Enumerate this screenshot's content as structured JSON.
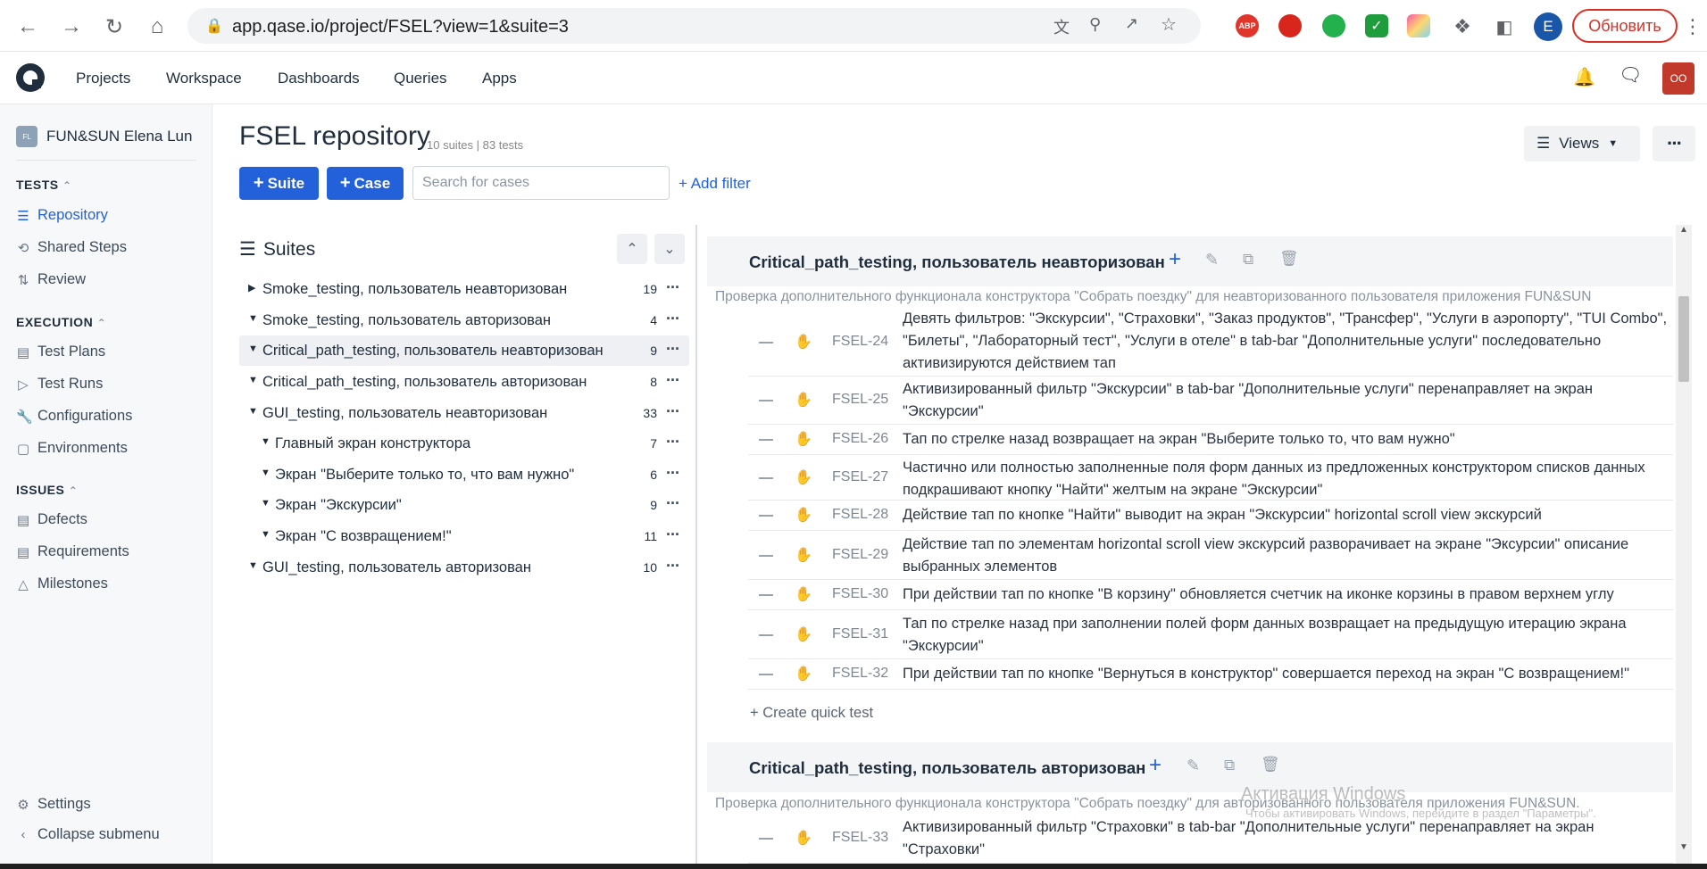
{
  "browser": {
    "url": "app.qase.io/project/FSEL?view=1&suite=3",
    "update_label": "Обновить",
    "profile_letter": "E"
  },
  "header": {
    "nav": [
      "Projects",
      "Workspace",
      "Dashboards",
      "Queries",
      "Apps"
    ],
    "avatar_initials": "OO"
  },
  "sidebar": {
    "project_name": "FUN&SUN Elena Lun",
    "project_badge": "FL",
    "sections": [
      {
        "title": "TESTS",
        "items": [
          "Repository",
          "Shared Steps",
          "Review"
        ]
      },
      {
        "title": "EXECUTION",
        "items": [
          "Test Plans",
          "Test Runs",
          "Configurations",
          "Environments"
        ]
      },
      {
        "title": "ISSUES",
        "items": [
          "Defects",
          "Requirements",
          "Milestones"
        ]
      }
    ],
    "settings_label": "Settings",
    "collapse_label": "Collapse submenu"
  },
  "main": {
    "title": "FSEL repository",
    "meta": "10 suites | 83 tests",
    "suite_button": "Suite",
    "case_button": "Case",
    "search_placeholder": "Search for cases",
    "add_filter": "+ Add filter",
    "views_label": "Views"
  },
  "suites_panel": {
    "title": "Suites",
    "tree": [
      {
        "label": "Smoke_testing, пользователь неавторизован",
        "count": "19",
        "level": 0,
        "expanded": false
      },
      {
        "label": "Smoke_testing, пользователь авторизован",
        "count": "4",
        "level": 0,
        "expanded": true
      },
      {
        "label": "Critical_path_testing, пользователь неавторизован",
        "count": "9",
        "level": 0,
        "expanded": true,
        "selected": true
      },
      {
        "label": "Critical_path_testing, пользователь авторизован",
        "count": "8",
        "level": 0,
        "expanded": true
      },
      {
        "label": "GUI_testing, пользователь неавторизован",
        "count": "33",
        "level": 0,
        "expanded": true
      },
      {
        "label": "Главный экран конструктора",
        "count": "7",
        "level": 1,
        "expanded": true
      },
      {
        "label": "Экран \"Выберите только то, что вам нужно\"",
        "count": "6",
        "level": 1,
        "expanded": true
      },
      {
        "label": "Экран \"Экскурсии\"",
        "count": "9",
        "level": 1,
        "expanded": true
      },
      {
        "label": "Экран \"С возвращением!\"",
        "count": "11",
        "level": 1,
        "expanded": true
      },
      {
        "label": "GUI_testing, пользователь авторизован",
        "count": "10",
        "level": 0,
        "expanded": true
      }
    ]
  },
  "detail": {
    "suite1": {
      "title": "Critical_path_testing, пользователь неавторизован",
      "description": "Проверка дополнительного функционала конструктора \"Собрать поездку\" для неавторизованного пользователя приложения FUN&SUN",
      "cases": [
        {
          "id": "FSEL-24",
          "title": "Девять фильтров: \"Экскурсии\", \"Страховки\", \"Заказ продуктов\", \"Трансфер\", \"Услуги в аэропорту\", \"TUI Combo\", \"Билеты\", \"Лабораторный тест\", \"Услуги в отеле\" в tab-bar \"Дополнительные услуги\" последовательно активизируются действием тап"
        },
        {
          "id": "FSEL-25",
          "title": "Активизированный фильтр \"Экскурсии\" в tab-bar \"Дополнительные услуги\" перенаправляет на экран \"Экскурсии\""
        },
        {
          "id": "FSEL-26",
          "title": "Тап по стрелке назад возвращает на экран \"Выберите только то, что вам нужно\""
        },
        {
          "id": "FSEL-27",
          "title": "Частично или полностью заполненные поля форм данных из предложенных конструктором списков данных подкрашивают кнопку \"Найти\" желтым на экране \"Экскурсии\""
        },
        {
          "id": "FSEL-28",
          "title": "Действие тап по кнопке \"Найти\" выводит на экран \"Экскурсии\" horizontal scroll view экскурсий"
        },
        {
          "id": "FSEL-29",
          "title": "Действие тап по элементам horizontal scroll view экскурсий разворачивает на экране \"Эксурсии\" описание выбранных элементов"
        },
        {
          "id": "FSEL-30",
          "title": "При действии тап по кнопке \"В корзину\" обновляется счетчик на иконке корзины в правом верхнем углу"
        },
        {
          "id": "FSEL-31",
          "title": "Тап по стрелке назад при заполнении полей форм данных возвращает на предыдущую итерацию экрана \"Экскурсии\""
        },
        {
          "id": "FSEL-32",
          "title": "При действии тап по кнопке \"Вернуться в конструктор\" совершается переход на экран \"С возвращением!\""
        }
      ],
      "quick_test": "+ Create quick test"
    },
    "suite2": {
      "title": "Critical_path_testing, пользователь авторизован",
      "description": "Проверка дополнительного функционала конструктора \"Собрать поездку\" для авторизованного пользователя приложения FUN&SUN.",
      "cases": [
        {
          "id": "FSEL-33",
          "title": "Активизированный фильтр \"Страховки\" в tab-bar \"Дополнительные услуги\" перенаправляет на экран \"Страховки\""
        }
      ]
    }
  },
  "watermark": {
    "line1": "Активация Windows",
    "line2": "Чтобы активировать Windows, перейдите в раздел \"Параметры\"."
  }
}
